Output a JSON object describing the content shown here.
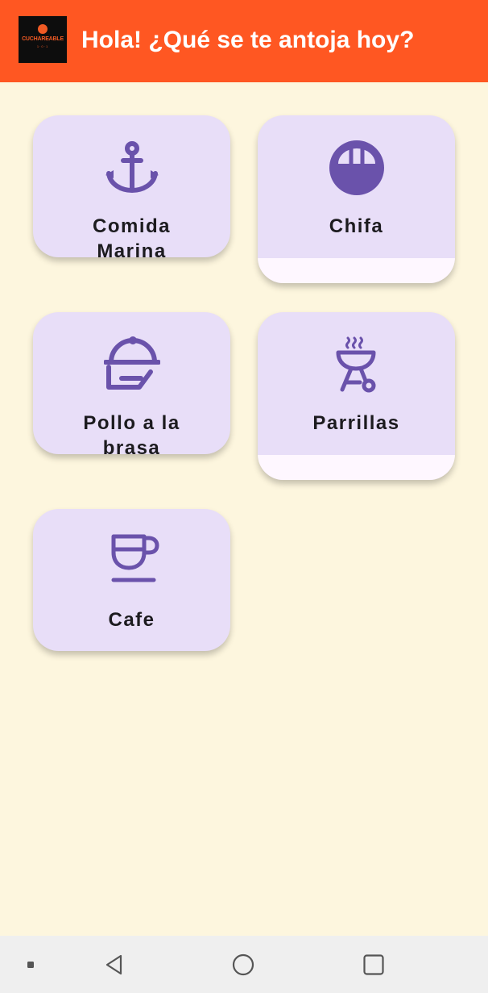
{
  "app_bar": {
    "title": "Hola! ¿Qué se te antoja hoy?",
    "logo": {
      "text": "CUCHAREABLE",
      "subtext": "1·0·1",
      "color": "#F05A24"
    },
    "background": "#FF5722"
  },
  "categories": [
    {
      "label_lines": [
        "Comida",
        "Marina"
      ],
      "icon": "anchor-icon"
    },
    {
      "label_lines": [
        "Chifa"
      ],
      "icon": "ramen-bowl-icon"
    },
    {
      "label_lines": [
        "Pollo a la",
        "brasa"
      ],
      "icon": "room-service-icon"
    },
    {
      "label_lines": [
        "Parrillas"
      ],
      "icon": "outdoor-grill-icon"
    },
    {
      "label_lines": [
        "Cafe"
      ],
      "icon": "coffee-cup-icon"
    }
  ],
  "colors": {
    "background": "#FDF6DE",
    "card": "#E8DEF8",
    "icon": "#6A52AB",
    "label": "#1C1B1F"
  },
  "nav_bar": {
    "buttons": [
      "recents-dot-icon",
      "back-icon",
      "home-icon",
      "overview-icon"
    ]
  }
}
